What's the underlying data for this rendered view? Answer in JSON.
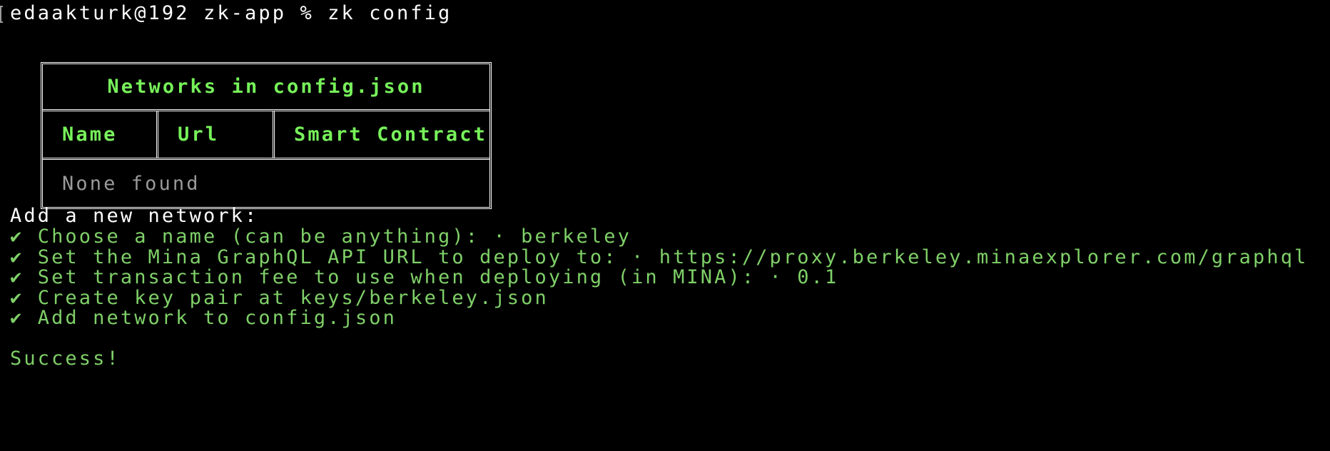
{
  "terminal": {
    "prompt": "edaakturk@192 zk-app % zk config"
  },
  "table": {
    "title": "Networks in config.json",
    "headers": [
      "Name",
      "Url",
      "Smart Contract"
    ],
    "empty_message": "None found"
  },
  "wizard": {
    "heading": "Add a new network:",
    "check_glyph": "✔",
    "steps": [
      {
        "text": "Choose a name (can be anything): · berkeley"
      },
      {
        "text": "Set the Mina GraphQL API URL to deploy to: · https://proxy.berkeley.minaexplorer.com/graphql"
      },
      {
        "text": "Set transaction fee to use when deploying (in MINA): · 0.1"
      },
      {
        "text": "Create key pair at keys/berkeley.json"
      },
      {
        "text": "Add network to config.json"
      }
    ],
    "success": "Success!"
  },
  "colors": {
    "background": "#000000",
    "header_green": "#77f25a",
    "step_green": "#7fd068",
    "muted_gray": "#9a9a9a",
    "text_white": "#ffffff"
  }
}
